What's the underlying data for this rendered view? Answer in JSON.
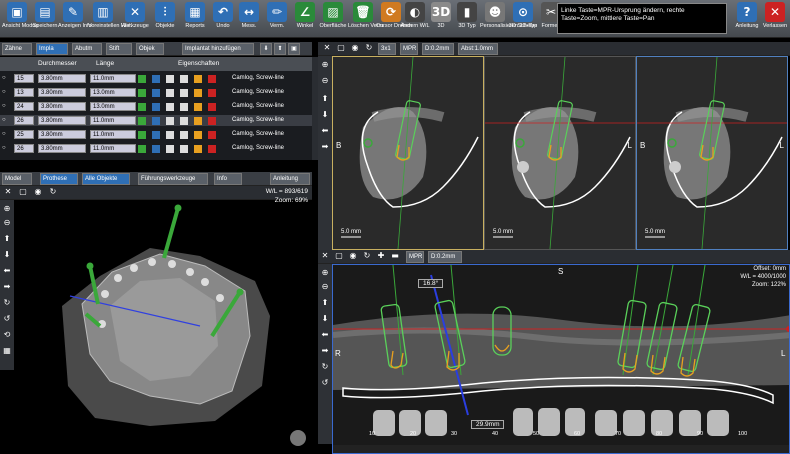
{
  "toolbar": {
    "buttons": [
      {
        "label": "Ansicht Modus",
        "icon": "view-mode-icon",
        "glyph": "▣",
        "color": "#2f6fb5"
      },
      {
        "label": "Speichern",
        "icon": "save-icon",
        "glyph": "▤",
        "color": "#2f6fb5"
      },
      {
        "label": "Anzeigen Info",
        "icon": "info-icon",
        "glyph": "✎",
        "color": "#2f6fb5"
      },
      {
        "label": "Voreinstellen Hist.",
        "icon": "histogram-icon",
        "glyph": "▥",
        "color": "#2f6fb5"
      },
      {
        "label": "Werkzeuge",
        "icon": "tools-icon",
        "glyph": "✕",
        "color": "#2f6fb5"
      },
      {
        "label": "Objekte",
        "icon": "implant-objects-icon",
        "glyph": "⫶",
        "color": "#2f6fb5"
      },
      {
        "label": "Reports",
        "icon": "reports-icon",
        "glyph": "▦",
        "color": "#2f6fb5"
      },
      {
        "label": "Undo",
        "icon": "undo-icon",
        "glyph": "↶",
        "color": "#2f6fb5"
      },
      {
        "label": "Mess.",
        "icon": "measure-icon",
        "glyph": "↔",
        "color": "#2f6fb5"
      },
      {
        "label": "Verm.",
        "icon": "pen-icon",
        "glyph": "✏",
        "color": "#2f6fb5"
      },
      {
        "label": "Winkel",
        "icon": "angle-icon",
        "glyph": "∠",
        "color": "#2a8a3a"
      },
      {
        "label": "Oberfläche",
        "icon": "surface-icon",
        "glyph": "▨",
        "color": "#2a8a3a"
      },
      {
        "label": "Löschen Verm.",
        "icon": "delete-icon",
        "glyph": "🗑",
        "color": "#2a8a3a"
      },
      {
        "label": "Cursor Drehen",
        "icon": "rotate-cursor-icon",
        "glyph": "⟳",
        "color": "#d07a20"
      },
      {
        "label": "Ändern W/L",
        "icon": "window-level-icon",
        "glyph": "◐",
        "color": "#444444"
      },
      {
        "label": "3D",
        "icon": "3d-icon",
        "glyph": "3D",
        "color": "#8a8a8a"
      },
      {
        "label": "3D Typ",
        "icon": "3d-type-icon",
        "glyph": "▮",
        "color": "#444444"
      },
      {
        "label": "Personalisieren 3D-Typ",
        "icon": "personalize-3d-icon",
        "glyph": "☻",
        "color": "#777777"
      },
      {
        "label": "3D Scheibe",
        "icon": "3d-slice-icon",
        "glyph": "⊙",
        "color": "#2f6fb5"
      },
      {
        "label": "Formen",
        "icon": "scissors-icon",
        "glyph": "✂",
        "color": "#555555"
      }
    ],
    "message": "Linke Taste=MPR-Ursprung ändern, rechte Taste=Zoom, mittlere Taste=Pan",
    "help_label": "Anleitung",
    "exit_label": "Verlassen"
  },
  "implant_tabs": {
    "items": [
      "Zähne",
      "Impla",
      "Abutm",
      "Stift",
      "Objek"
    ],
    "add_button": "Implantat hinzufügen"
  },
  "implant_table": {
    "headers": [
      "Durchmesser",
      "Länge",
      "Eigenschaften"
    ],
    "rows": [
      {
        "id": "15",
        "diameter": "3.80mm",
        "length": "11.0mm",
        "name": "Camlog, Screw-line"
      },
      {
        "id": "13",
        "diameter": "3.80mm",
        "length": "13.0mm",
        "name": "Camlog, Screw-line"
      },
      {
        "id": "24",
        "diameter": "3.80mm",
        "length": "13.0mm",
        "name": "Camlog, Screw-line"
      },
      {
        "id": "26",
        "diameter": "3.80mm",
        "length": "11.0mm",
        "name": "Camlog, Screw-line"
      },
      {
        "id": "25",
        "diameter": "3.80mm",
        "length": "11.0mm",
        "name": "Camlog, Screw-line"
      },
      {
        "id": "26",
        "diameter": "3.80mm",
        "length": "11.0mm",
        "name": "Camlog, Screw-line"
      }
    ]
  },
  "view3d_strip": {
    "items": [
      "Model",
      "Prothese",
      "Alle Objekte",
      "Führungswerkzeuge",
      "Info"
    ],
    "guide_label": "Anleitung"
  },
  "view3d": {
    "wl": "W/L = 893/619",
    "zoom": "Zoom: 69%"
  },
  "cross_strip": {
    "items": [
      "3x1",
      "MPR",
      "D:0.2mm",
      "Abst:1.0mm"
    ]
  },
  "cross_views": [
    {
      "left": "B",
      "right": "",
      "scale": "5.0 mm"
    },
    {
      "left": "",
      "right": "L",
      "scale": "5.0 mm"
    },
    {
      "left": "B",
      "right": "L",
      "scale": "5.0 mm"
    }
  ],
  "pano": {
    "strip": [
      "MPR",
      "D:0.2mm"
    ],
    "orientation_top": "S",
    "orientation_left": "R",
    "orientation_right": "L",
    "offset": "Offset: 0mm",
    "wl": "W/L = 4000/1000",
    "zoom": "Zoom: 122%",
    "angle": "16.8°",
    "distance": "29.9mm",
    "ruler": [
      "10",
      "20",
      "30",
      "40",
      "50",
      "60",
      "70",
      "80",
      "90",
      "100"
    ]
  },
  "colors": {
    "toolbar_blue": "#2f6fb5",
    "implant_green": "#3aa83a",
    "highlight_blue": "#2a3ee0",
    "panel_border_yellow": "#c8b060"
  }
}
